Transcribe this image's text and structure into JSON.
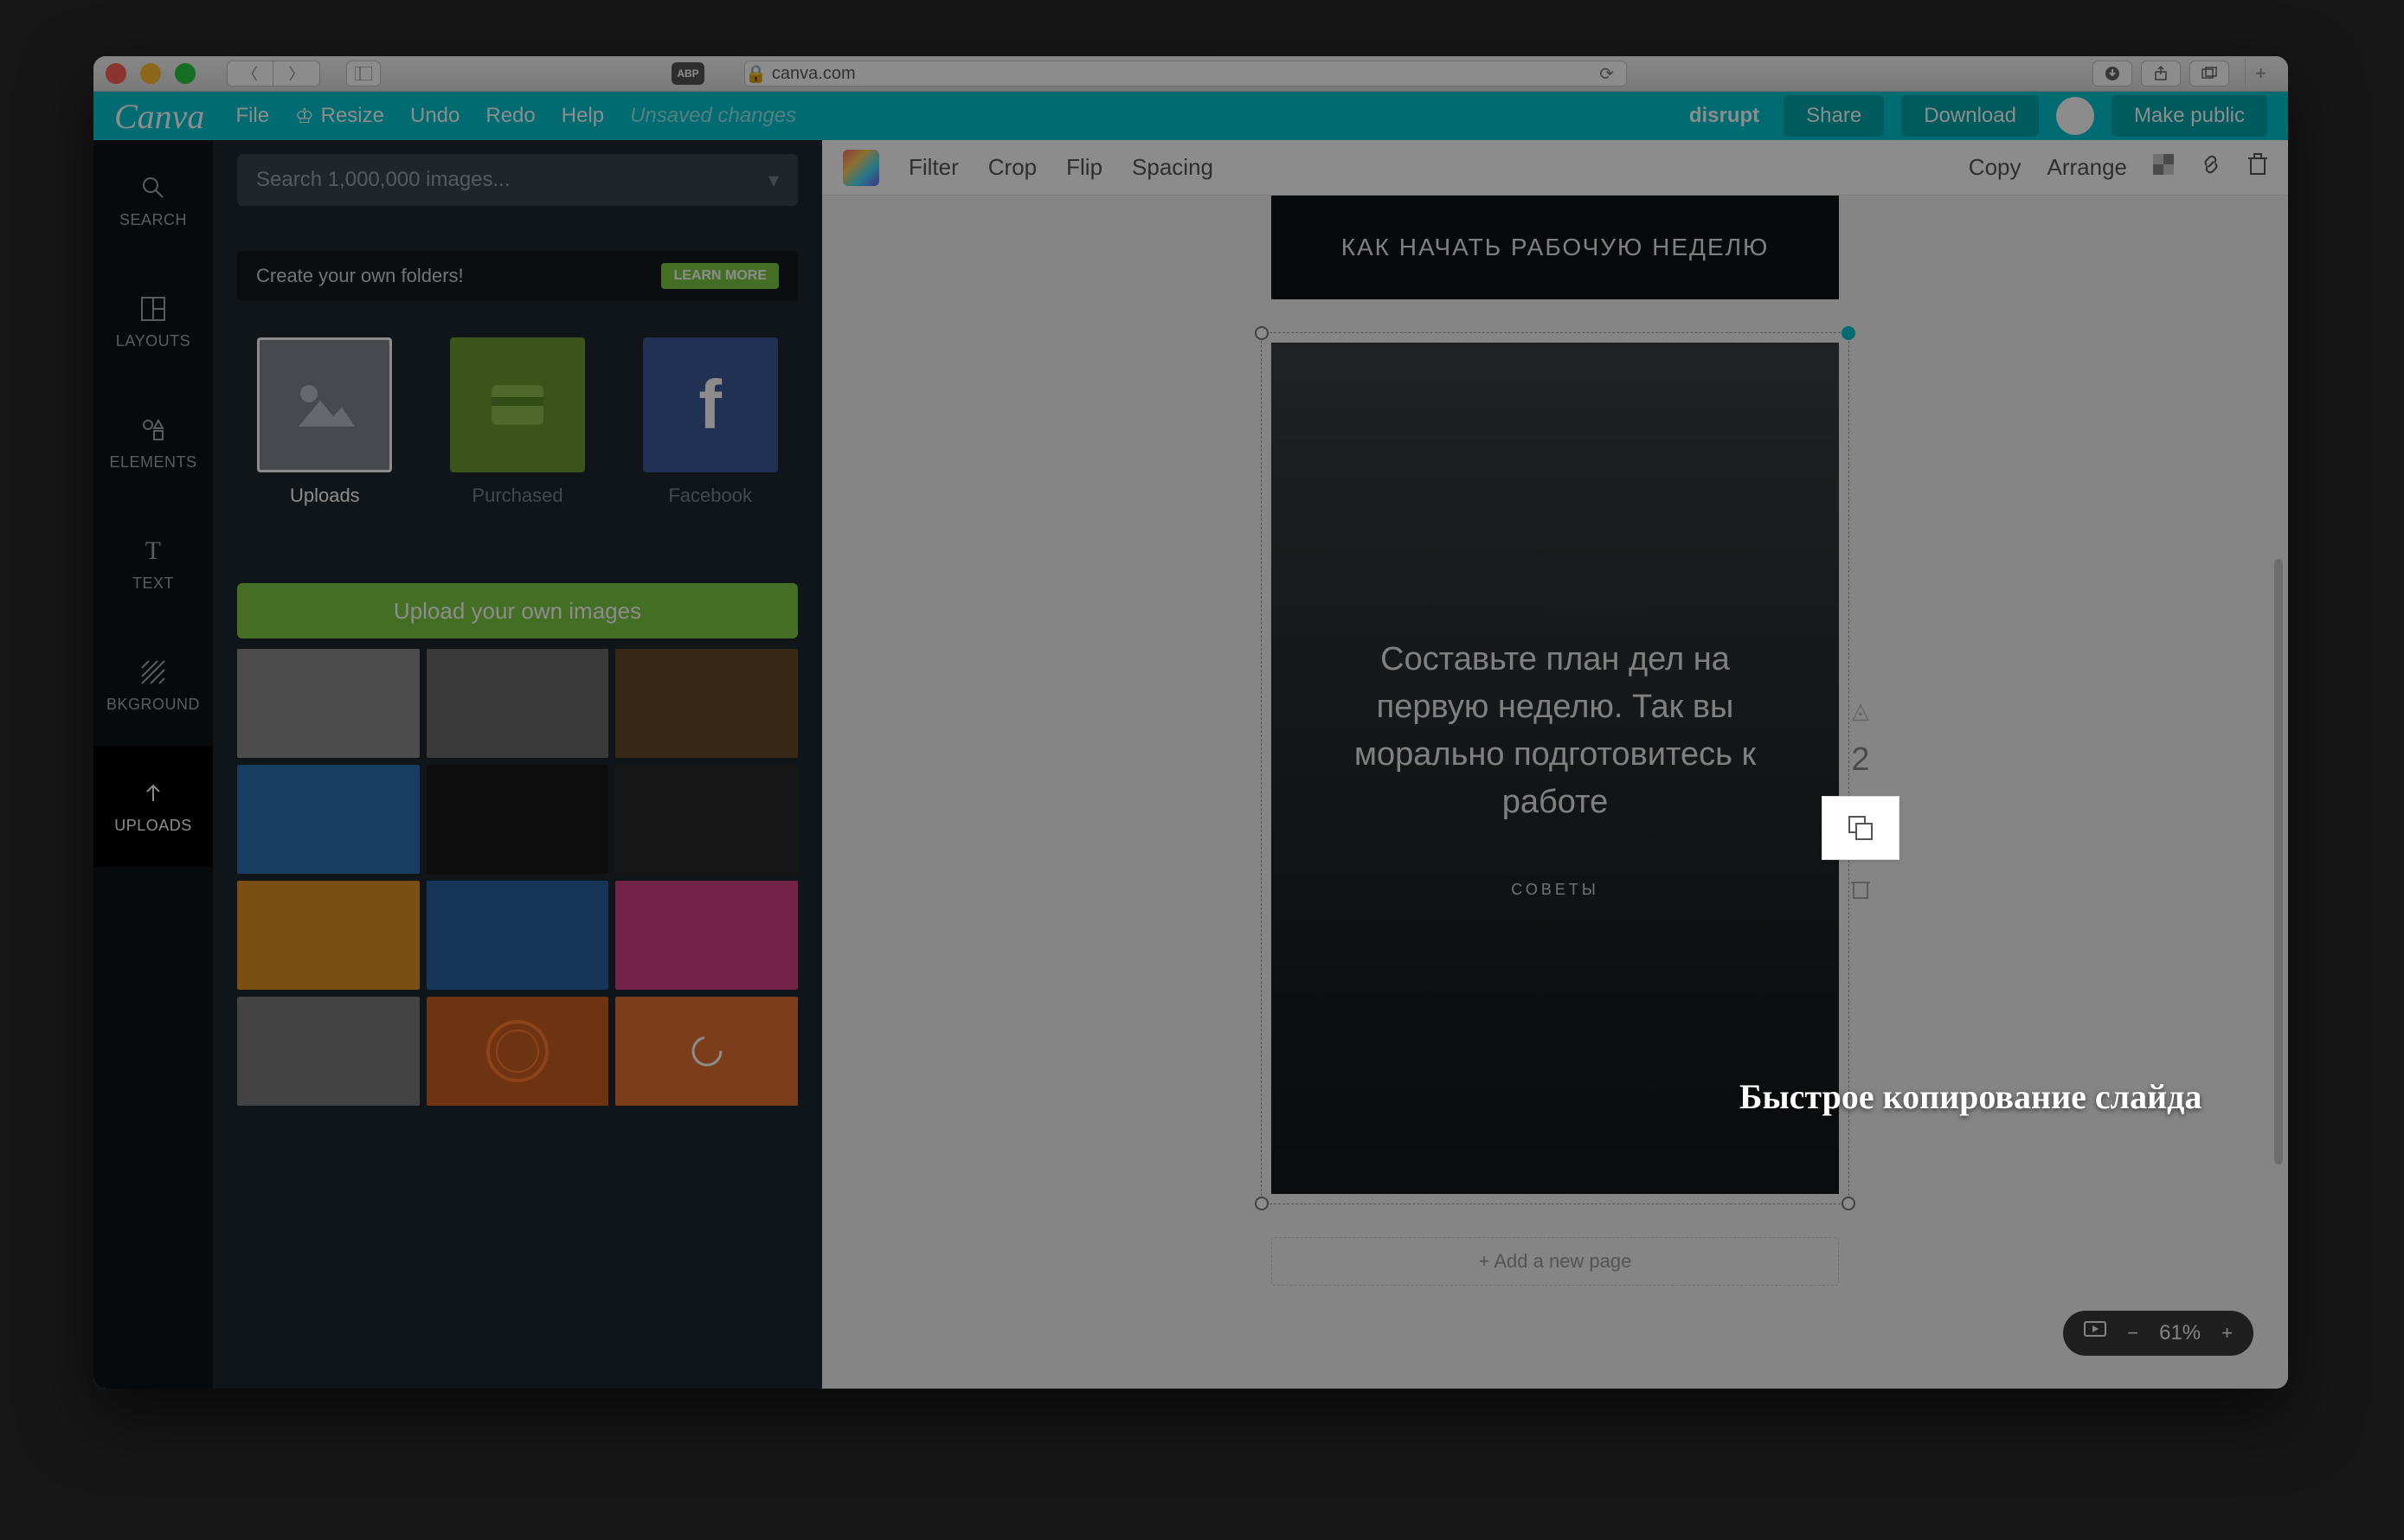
{
  "browser": {
    "url": "canva.com",
    "abp": "ABP"
  },
  "topbar": {
    "logo": "Canva",
    "file": "File",
    "resize": "Resize",
    "undo": "Undo",
    "redo": "Redo",
    "help": "Help",
    "unsaved": "Unsaved changes",
    "brand": "disrupt",
    "share": "Share",
    "download": "Download",
    "make_public": "Make public"
  },
  "left_rail": {
    "search": "SEARCH",
    "layouts": "LAYOUTS",
    "elements": "ELEMENTS",
    "text": "TEXT",
    "bkground": "BKGROUND",
    "uploads": "UPLOADS"
  },
  "side_panel": {
    "search_placeholder": "Search 1,000,000 images...",
    "create_folders": "Create your own folders!",
    "learn_more": "LEARN MORE",
    "tabs": {
      "uploads": "Uploads",
      "purchased": "Purchased",
      "facebook": "Facebook"
    },
    "upload_btn": "Upload your own images"
  },
  "toolbar": {
    "filter": "Filter",
    "crop": "Crop",
    "flip": "Flip",
    "spacing": "Spacing",
    "copy": "Copy",
    "arrange": "Arrange"
  },
  "canvas": {
    "top_slide_text": "КАК НАЧАТЬ РАБОЧУЮ НЕДЕЛЮ",
    "main_text": "Составьте план дел на первую неделю. Так вы морально подготовитесь к работе",
    "subtitle": "СОВЕТЫ",
    "page_number": "2",
    "add_page": "+ Add a new page"
  },
  "zoom": {
    "level": "61%"
  },
  "tooltip": "Быстрое копирование слайда",
  "thumb_colors": [
    "#8a8a8a",
    "#6a6a6a",
    "#6b4a2a",
    "#2a6fb3",
    "#1a1a1a",
    "#2a2a2a",
    "#e09020",
    "#2a5fa3",
    "#d04080",
    "#7a7a7a",
    "#c86020",
    "#e07030"
  ]
}
